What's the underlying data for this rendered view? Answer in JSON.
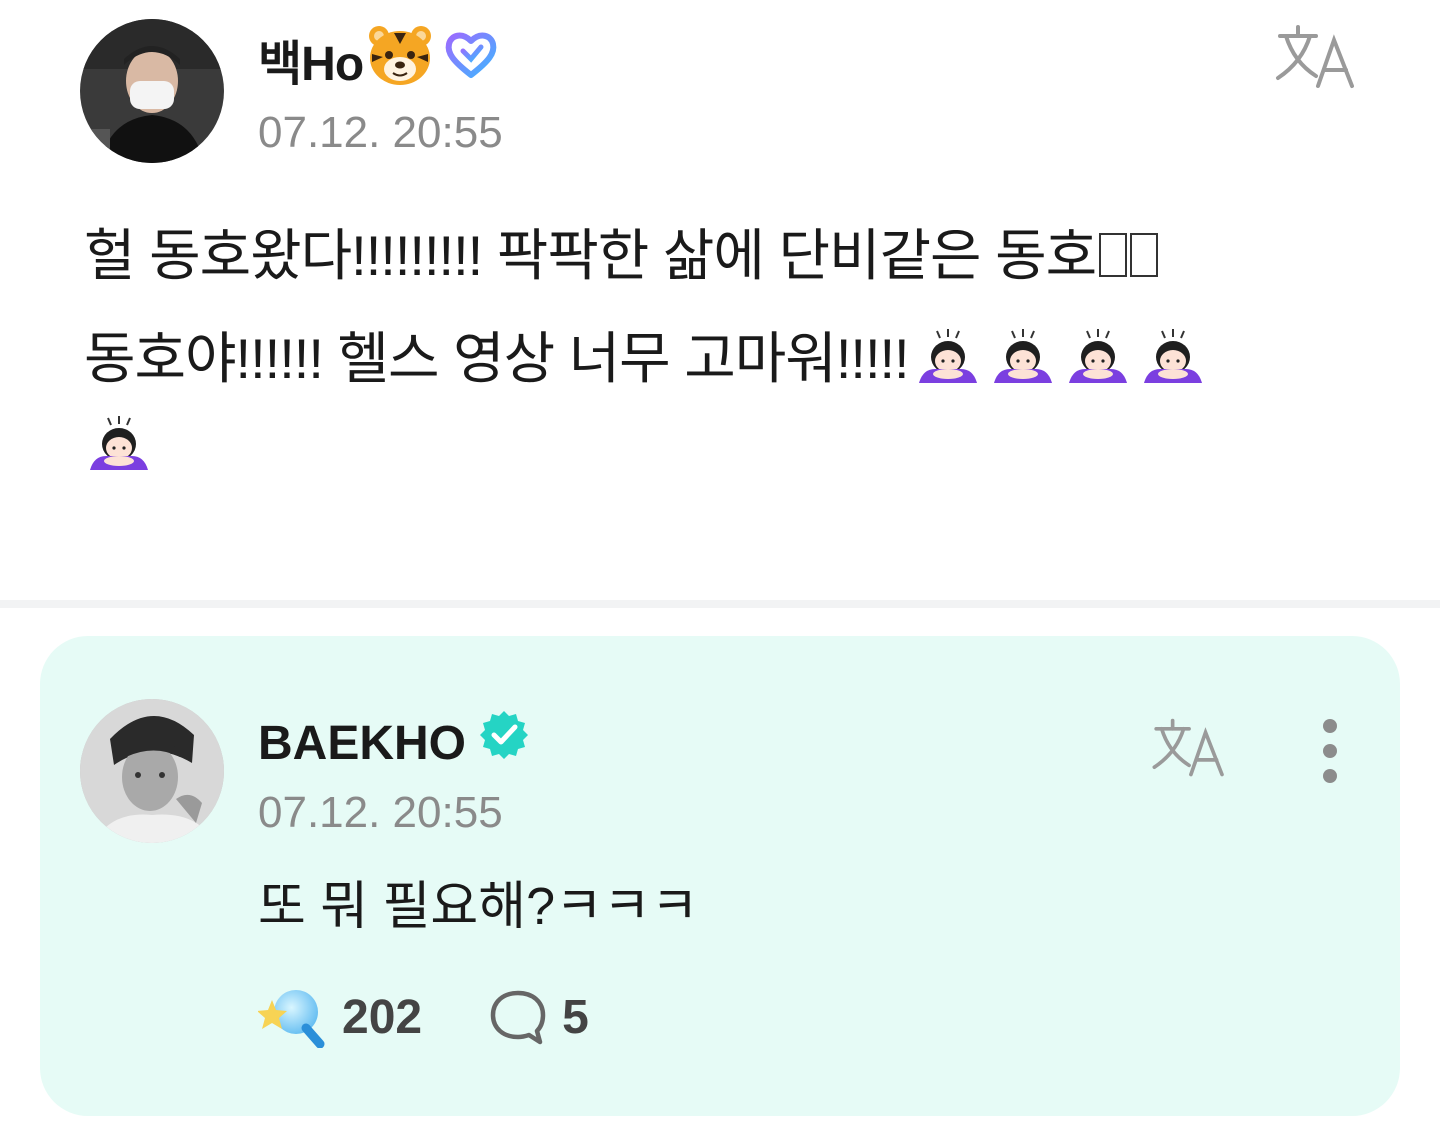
{
  "post": {
    "username": "백Ho",
    "timestamp": "07.12. 20:55",
    "text_line1": "헐 동호왔다!!!!!!!!! 팍팍한 삶에 단비같은 동호",
    "text_line2": "동호야!!!!!! 헬스 영상 너무 고마워!!!!!"
  },
  "reply": {
    "username": "BAEKHO",
    "timestamp": "07.12. 20:55",
    "text": "또 뭐 필요해?ㅋㅋㅋ",
    "like_count": "202",
    "comment_count": "5"
  },
  "icons": {
    "translate": "translate-icon",
    "more": "more-vertical-icon",
    "verified": "verified-badge-icon",
    "membership": "membership-heart-icon",
    "tiger": "tiger-face-emoji",
    "bow": "bowing-woman-emoji",
    "like": "lightstick-icon",
    "comment": "comment-bubble-icon"
  },
  "colors": {
    "reply_bg": "#e6fbf6",
    "verified": "#25d4c4",
    "timestamp": "#8a8a8a",
    "bow_purple": "#7b3fe0"
  }
}
